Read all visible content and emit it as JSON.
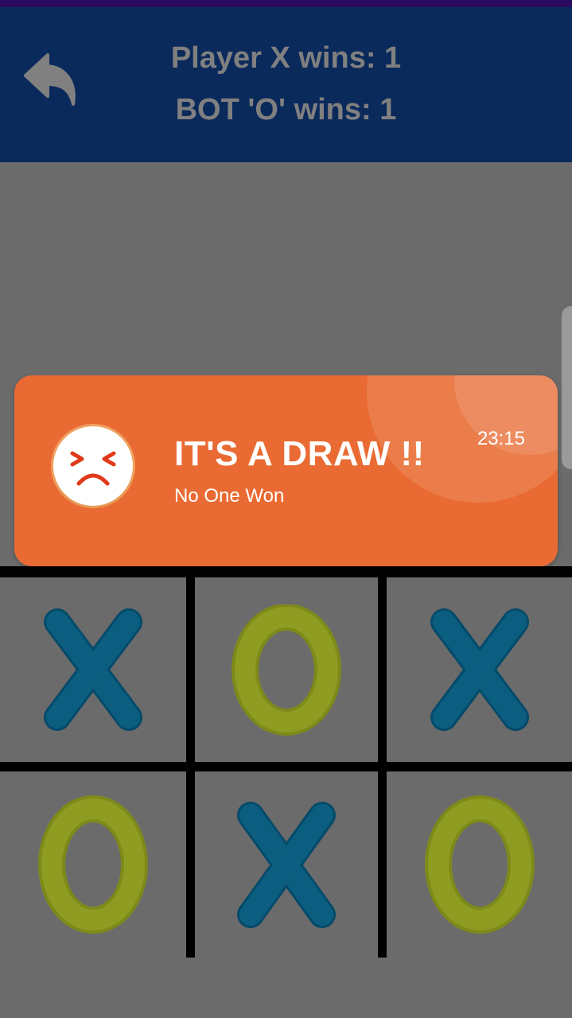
{
  "header": {
    "player_x_wins": "Player X wins: 1",
    "bot_o_wins": "BOT 'O' wins: 1"
  },
  "toast": {
    "title": "IT'S A DRAW !!",
    "subtitle": "No One Won",
    "time": "23:15"
  },
  "board": {
    "cells": [
      {
        "mark": "X"
      },
      {
        "mark": "O"
      },
      {
        "mark": "X"
      },
      {
        "mark": "O"
      },
      {
        "mark": "X"
      },
      {
        "mark": "O"
      }
    ]
  },
  "colors": {
    "x_mark": "#0b5e7f",
    "o_mark": "#8a9a1e",
    "toast_bg": "#e96b33",
    "header_bg": "#0b2a5c"
  },
  "icons": {
    "back": "undo-arrow-icon",
    "emoji": "frowning-face-icon"
  }
}
